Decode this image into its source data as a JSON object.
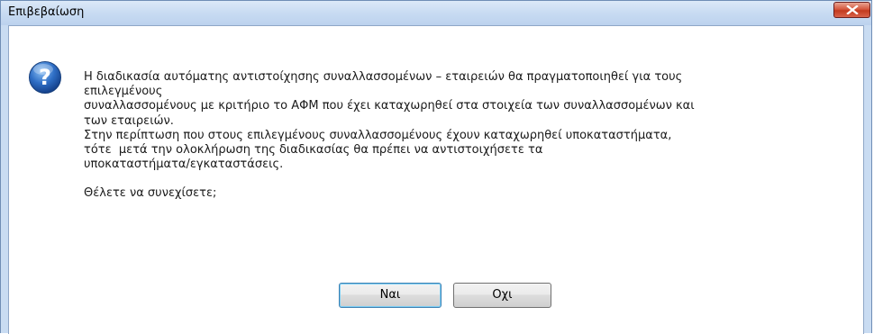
{
  "window": {
    "title": "Επιβεβαίωση",
    "close_icon": "close-icon"
  },
  "dialog": {
    "icon": "question-icon",
    "message_lines": [
      "Η διαδικασία αυτόματης αντιστοίχησης συναλλασσομένων – εταιρειών θα πραγματοποιηθεί για τους",
      "επιλεγμένους",
      "συναλλασσομένους με κριτήριο το ΑΦΜ που έχει καταχωρηθεί στα στοιχεία των συναλλασσομένων και",
      "των εταιρειών.",
      "Στην περίπτωση που στους επιλεγμένους συναλλασσομένους έχουν καταχωρηθεί υποκαταστήματα,",
      "τότε  μετά την ολοκλήρωση της διαδικασίας θα πρέπει να αντιστοιχήσετε τα",
      "υποκαταστήματα/εγκαταστάσεις."
    ],
    "question": "Θέλετε να συνεχίσετε;"
  },
  "buttons": {
    "yes_label": "Ναι",
    "no_label": "Οχι"
  },
  "colors": {
    "titlebar": "#c8dbf2",
    "close_button": "#c23a1f",
    "icon_blue": "#1f5fb8"
  }
}
